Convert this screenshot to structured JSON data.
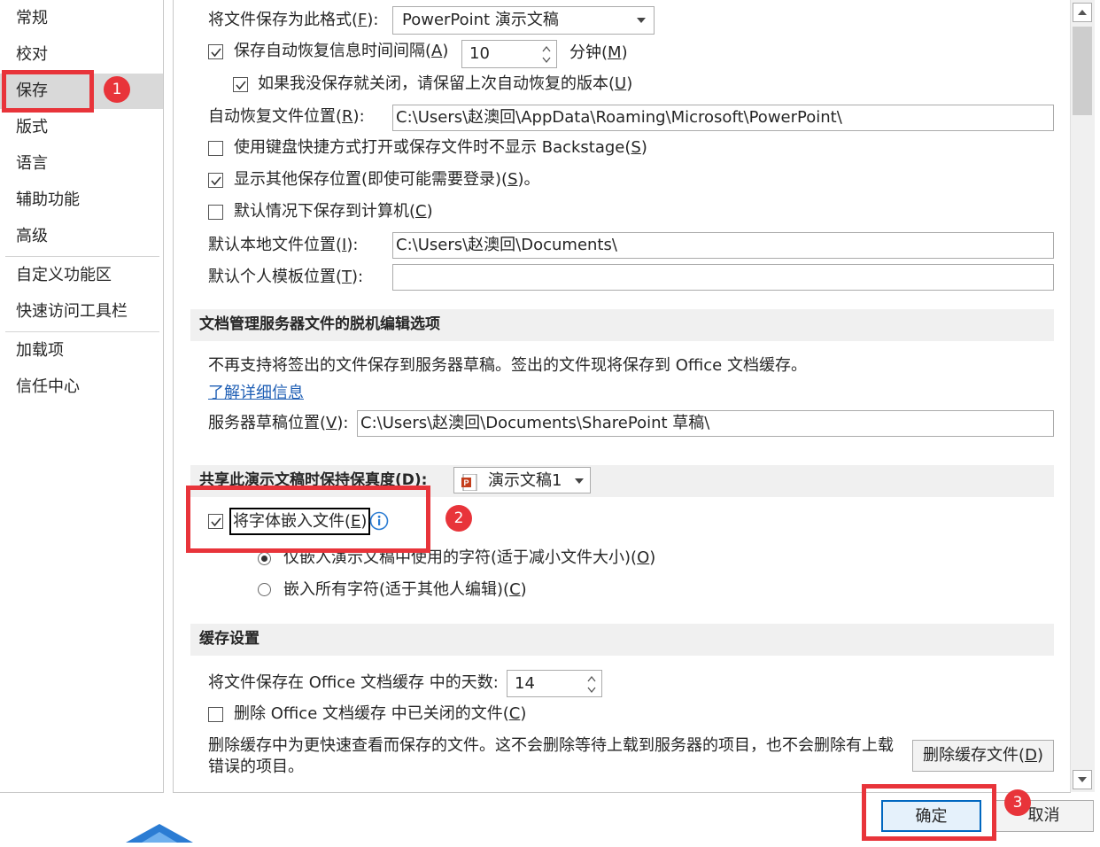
{
  "nav": {
    "items": [
      {
        "label": "常规"
      },
      {
        "label": "校对"
      },
      {
        "label": "保存"
      },
      {
        "label": "版式"
      },
      {
        "label": "语言"
      },
      {
        "label": "辅助功能"
      },
      {
        "label": "高级"
      },
      {
        "label": "自定义功能区"
      },
      {
        "label": "快速访问工具栏"
      },
      {
        "label": "加载项"
      },
      {
        "label": "信任中心"
      }
    ],
    "selected": "保存"
  },
  "save": {
    "format_label_pre": "将文件保存为此格式(",
    "format_label_key": "F",
    "format_label_post": "):",
    "format_value": "PowerPoint 演示文稿",
    "autorecover_pre": "保存自动恢复信息时间间隔(",
    "autorecover_key": "A",
    "autorecover_post": ")",
    "autorecover_checked": true,
    "autorecover_minutes": "10",
    "minutes_pre": "分钟(",
    "minutes_key": "M",
    "minutes_post": ")",
    "keep_last_pre": "如果我没保存就关闭，请保留上次自动恢复的版本(",
    "keep_last_key": "U",
    "keep_last_post": ")",
    "keep_last_checked": true,
    "autorecover_loc_pre": "自动恢复文件位置(",
    "autorecover_loc_key": "R",
    "autorecover_loc_post": "):",
    "autorecover_loc_value": "C:\\Users\\赵澳回\\AppData\\Roaming\\Microsoft\\PowerPoint\\",
    "no_backstage_pre": "使用键盘快捷方式打开或保存文件时不显示 Backstage(",
    "no_backstage_key": "S",
    "no_backstage_post": ")",
    "no_backstage_checked": false,
    "show_other_pre": "显示其他保存位置(即使可能需要登录)(",
    "show_other_key": "S",
    "show_other_post": ")。",
    "show_other_checked": true,
    "default_computer_pre": "默认情况下保存到计算机(",
    "default_computer_key": "C",
    "default_computer_post": ")",
    "default_computer_checked": false,
    "local_loc_pre": "默认本地文件位置(",
    "local_loc_key": "I",
    "local_loc_post": "):",
    "local_loc_value": "C:\\Users\\赵澳回\\Documents\\",
    "template_loc_pre": "默认个人模板位置(",
    "template_loc_key": "T",
    "template_loc_post": "):",
    "template_loc_value": ""
  },
  "offline": {
    "header": "文档管理服务器文件的脱机编辑选项",
    "notice": "不再支持将签出的文件保存到服务器草稿。签出的文件现将保存到 Office 文档缓存。",
    "learn_more": "了解详细信息",
    "drafts_pre": "服务器草稿位置(",
    "drafts_key": "V",
    "drafts_post": "):",
    "drafts_value": "C:\\Users\\赵澳回\\Documents\\SharePoint 草稿\\"
  },
  "fidelity": {
    "header": "共享此演示文稿时保持保真度(D):",
    "doc_value": "演示文稿1",
    "embed_pre": "将字体嵌入文件(",
    "embed_key": "E",
    "embed_post": ")",
    "embed_checked": true,
    "only_used_pre": "仅嵌入演示文稿中使用的字符(适于减小文件大小)(",
    "only_used_key": "O",
    "only_used_post": ")",
    "only_used_selected": true,
    "all_chars_pre": "嵌入所有字符(适于其他人编辑)(",
    "all_chars_key": "C",
    "all_chars_post": ")",
    "all_chars_selected": false
  },
  "cache": {
    "header": "缓存设置",
    "days_label": "将文件保存在 Office 文档缓存 中的天数:",
    "days_value": "14",
    "delete_closed_pre": "删除 Office 文档缓存 中已关闭的文件(",
    "delete_closed_key": "C",
    "delete_closed_post": ")",
    "delete_closed_checked": false,
    "desc_line1": "删除缓存中为更快速查看而保存的文件。这不会删除等待上载到服务器的项目，也不会删除有上载",
    "desc_line2": "错误的项目。",
    "delete_btn_pre": "删除缓存文件(",
    "delete_btn_key": "D",
    "delete_btn_post": ")"
  },
  "footer": {
    "ok_label": "确定",
    "cancel_label": "取消"
  },
  "annotations": {
    "badge1": "1",
    "badge2": "2",
    "badge3": "3"
  },
  "colors": {
    "annotation_red": "#e8343a",
    "link_blue": "#1f5fb5",
    "ppt_orange": "#c43e1c",
    "info_blue": "#2b7cd3"
  }
}
